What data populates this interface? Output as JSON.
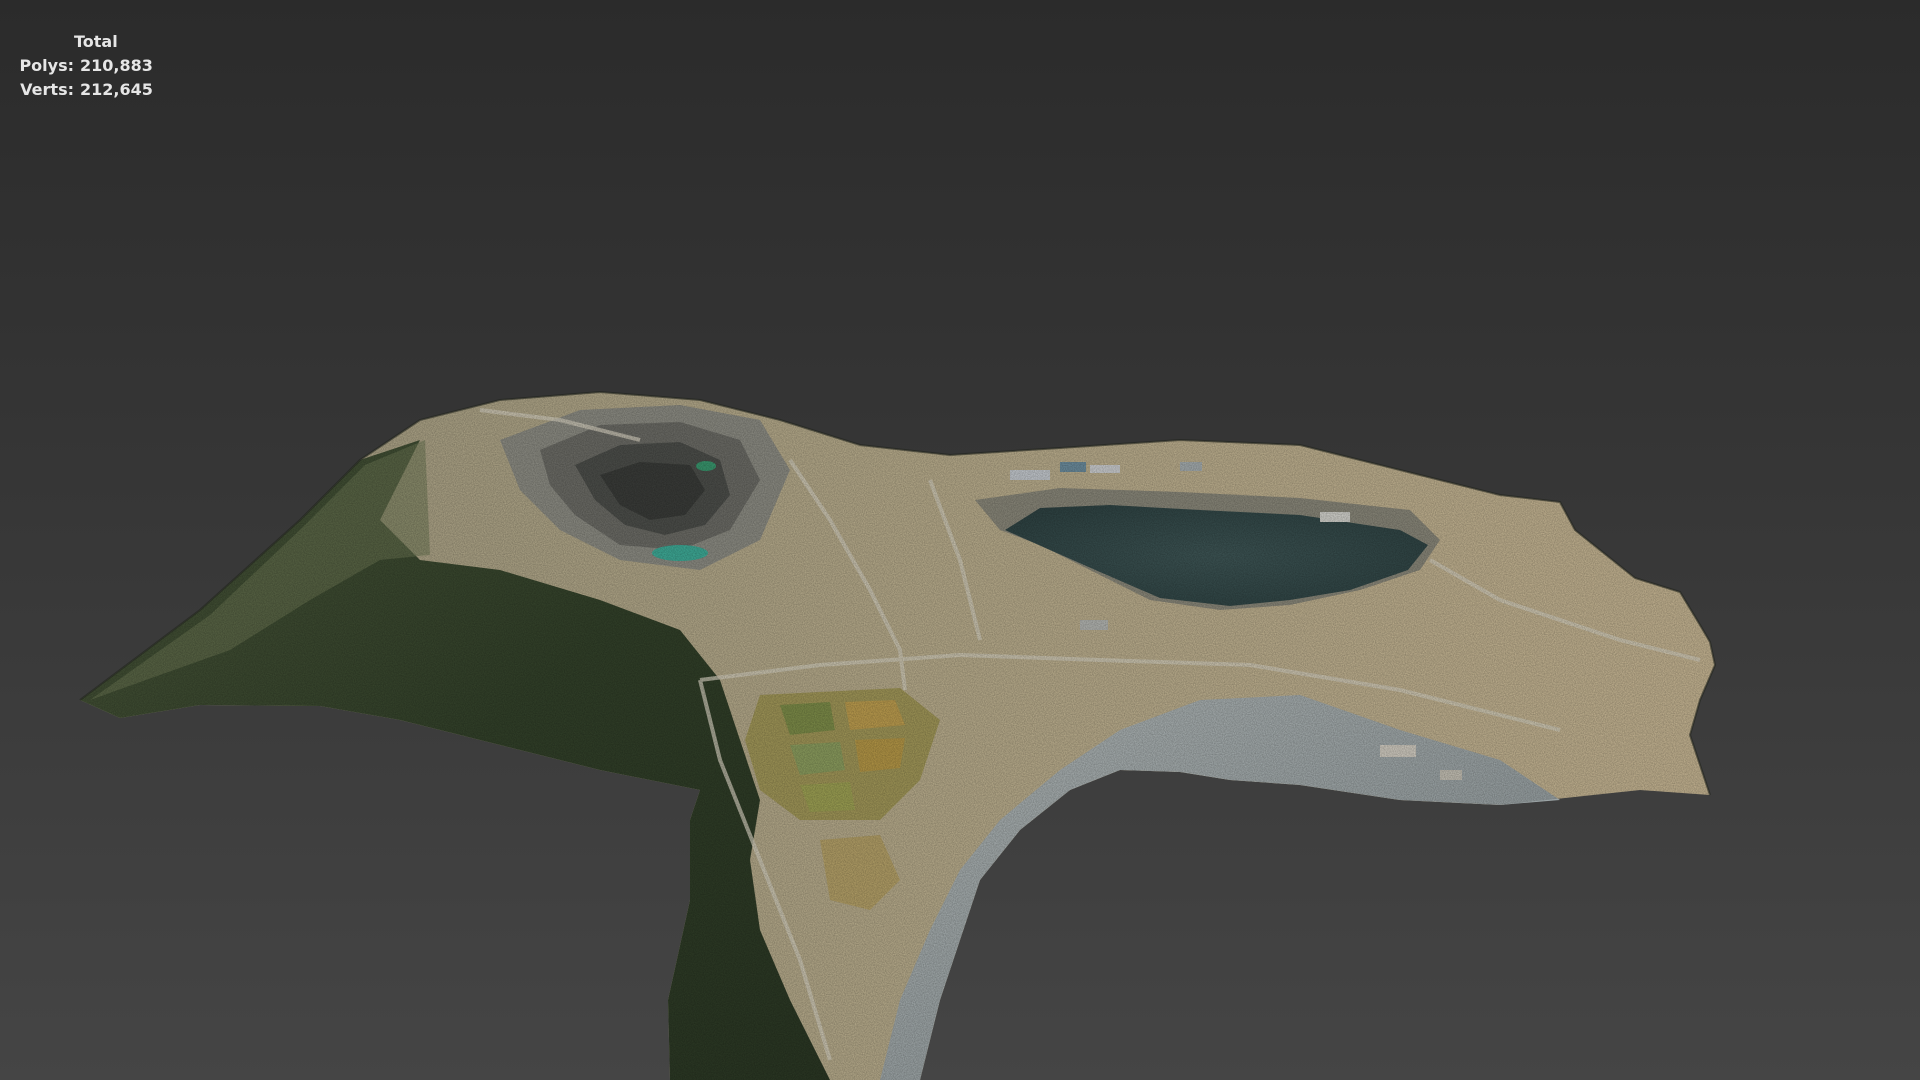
{
  "stats": {
    "title": "Total",
    "polys_label": "Polys:",
    "polys_value": "210,883",
    "verts_label": "Verts:",
    "verts_value": "212,645"
  },
  "colors": {
    "background_top": "#2b2b2b",
    "background_bottom": "#454545",
    "stats_text": "#e6e6e6",
    "pit_lake": "#3a5050",
    "forest": "#3c4a30",
    "mine_terrain": "#b9ad8c",
    "waste_dump": "#9aa3a6"
  },
  "viewport": {
    "content": "textured-terrain-mesh"
  }
}
